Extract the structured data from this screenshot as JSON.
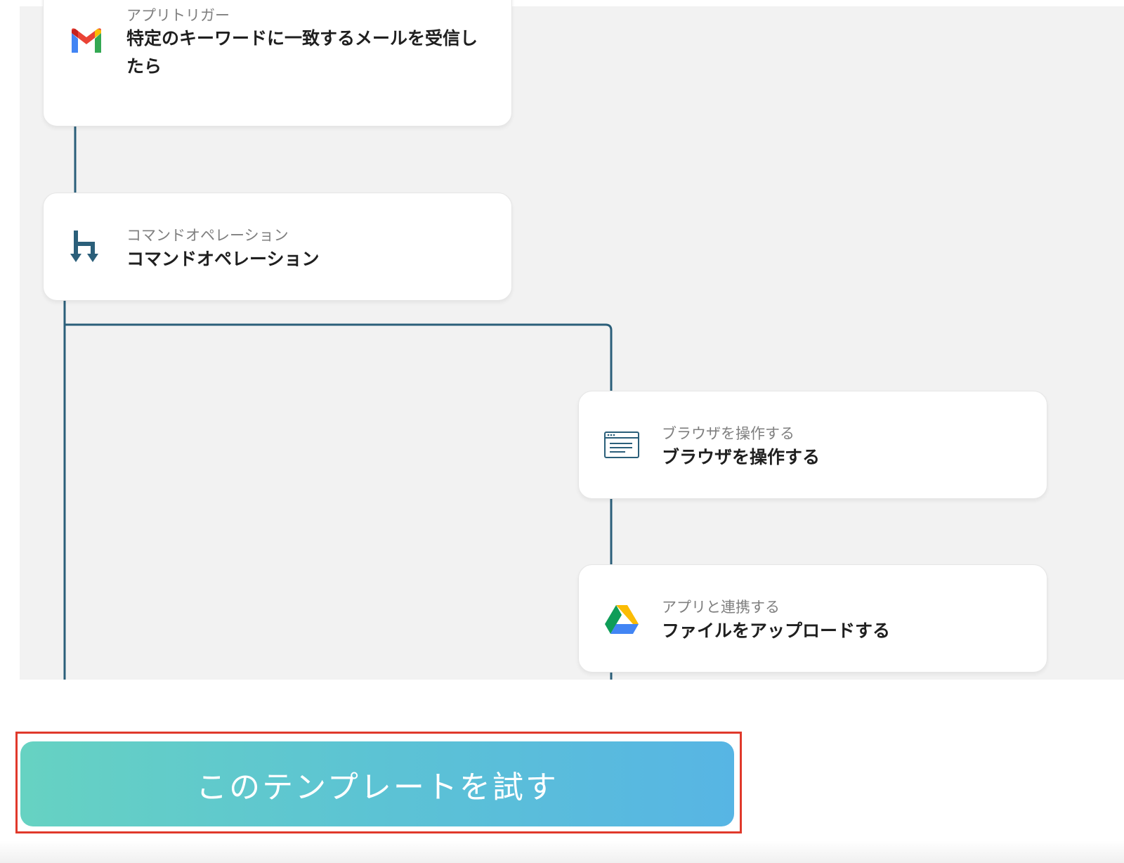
{
  "colors": {
    "canvas": "#f2f2f2",
    "connector": "#2b5f7a",
    "cta_gradient_start": "#66d2c2",
    "cta_gradient_end": "#57b5e4",
    "highlight_frame": "#e0392b"
  },
  "flow": {
    "steps": [
      {
        "icon": "gmail-icon",
        "subtitle": "アプリトリガー",
        "title": "特定のキーワードに一致するメールを受信したら"
      },
      {
        "icon": "branch-icon",
        "subtitle": "コマンドオペレーション",
        "title": "コマンドオペレーション"
      },
      {
        "icon": "browser-window-icon",
        "subtitle": "ブラウザを操作する",
        "title": "ブラウザを操作する"
      },
      {
        "icon": "google-drive-icon",
        "subtitle": "アプリと連携する",
        "title": "ファイルをアップロードする"
      }
    ]
  },
  "cta": {
    "label": "このテンプレートを試す"
  }
}
